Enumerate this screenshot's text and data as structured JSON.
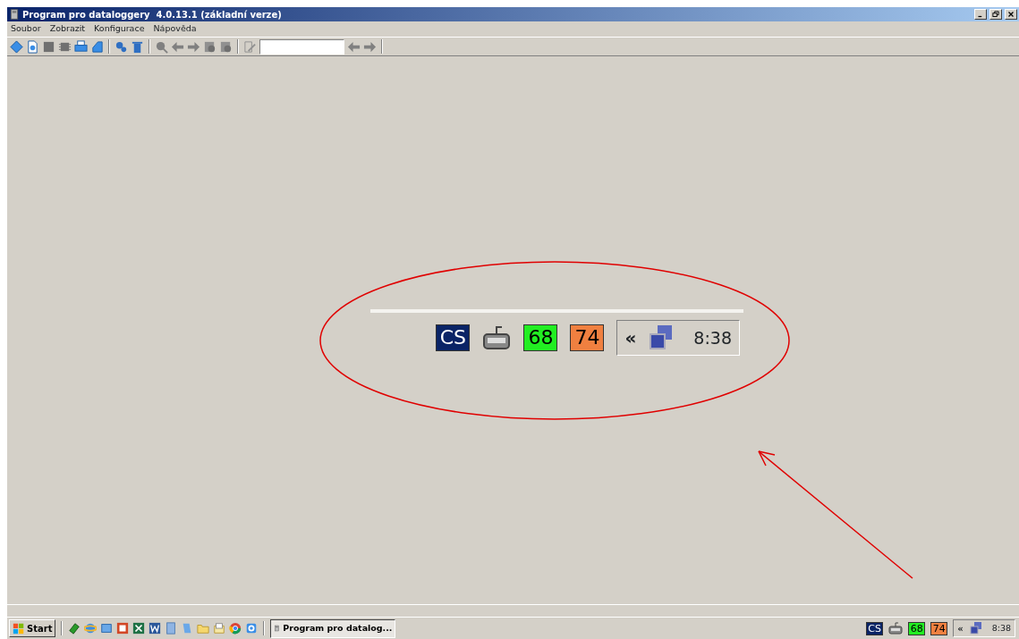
{
  "window": {
    "title": "Program pro dataloggery  4.0.13.1 (základní verze)"
  },
  "menu": [
    {
      "label": "Soubor"
    },
    {
      "label": "Zobrazit"
    },
    {
      "label": "Konfigurace"
    },
    {
      "label": "Nápověda"
    }
  ],
  "magnified_tray": {
    "items": [
      {
        "kind": "badge",
        "text": "CS",
        "color": "#0a2466"
      },
      {
        "kind": "keyboard"
      },
      {
        "kind": "badge",
        "text": "68",
        "color": "#22ee22"
      },
      {
        "kind": "badge",
        "text": "74",
        "color": "#f08040"
      }
    ],
    "expand": "«",
    "clock": "8:38"
  },
  "taskbar": {
    "start": "Start",
    "tasks": [
      {
        "label": "Program pro datalog...",
        "selected": true
      }
    ],
    "tray": {
      "items": [
        {
          "kind": "badge",
          "text": "CS",
          "color": "#0a2466"
        },
        {
          "kind": "keyboard"
        },
        {
          "kind": "badge",
          "text": "68",
          "color": "#22ee22"
        },
        {
          "kind": "badge",
          "text": "74",
          "color": "#f08040"
        }
      ],
      "expand": "«",
      "clock": "8:38"
    }
  }
}
